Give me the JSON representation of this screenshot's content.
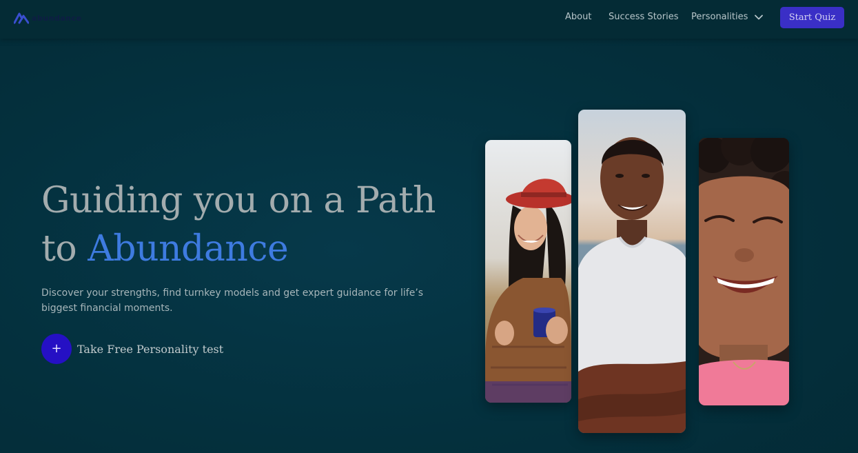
{
  "brand": {
    "name": "abundance",
    "accent_color": "#3e7be0",
    "button_color": "#3a2fc6"
  },
  "nav": {
    "links": [
      {
        "label": "About"
      },
      {
        "label": "Success Stories"
      },
      {
        "label": "Personalities"
      }
    ],
    "dropdown_icon": "chevron-down-icon",
    "cta_label": "Start Quiz"
  },
  "hero": {
    "headline_line1": "Guiding you on a Path",
    "headline_to": "to ",
    "headline_accent": "Abundance",
    "subtext": "Discover your strengths, find turnkey models and get expert guidance for life’s biggest financial moments.",
    "cta_icon": "+",
    "cta_label": "Take Free Personality test"
  },
  "photos": [
    {
      "subject": "woman-red-hat-holding-mug"
    },
    {
      "subject": "man-white-tshirt-smiling"
    },
    {
      "subject": "woman-curly-hair-laughing"
    }
  ]
}
